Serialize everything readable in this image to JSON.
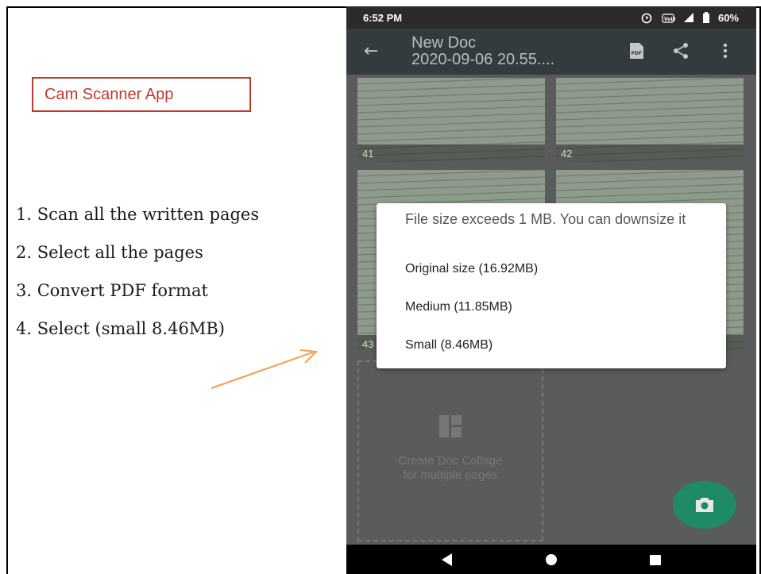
{
  "annotation": {
    "title": "Cam Scanner App",
    "steps": [
      "1. Scan all the written pages",
      "2. Select all the pages",
      "3. Convert PDF format",
      "4. Select (small 8.46MB)"
    ],
    "title_color": "#c0392b",
    "arrow_color": "#f0a050"
  },
  "phone": {
    "status": {
      "time": "6:52 PM",
      "battery": "60%"
    },
    "toolbar": {
      "title_line1": "New Doc",
      "title_line2": "2020-09-06 20.55....",
      "icons": [
        "back-arrow-icon",
        "pdf-icon",
        "share-icon",
        "more-vert-icon"
      ]
    },
    "pages": [
      "41",
      "42",
      "43"
    ],
    "collage": {
      "line1": "Create Doc Collage",
      "line2": "for multiple pages"
    },
    "dialog": {
      "title": "File size exceeds 1 MB. You can downsize it",
      "options": [
        "Original size (16.92MB)",
        "Medium (11.85MB)",
        "Small (8.46MB)"
      ]
    },
    "accent": "#1e8a68"
  }
}
